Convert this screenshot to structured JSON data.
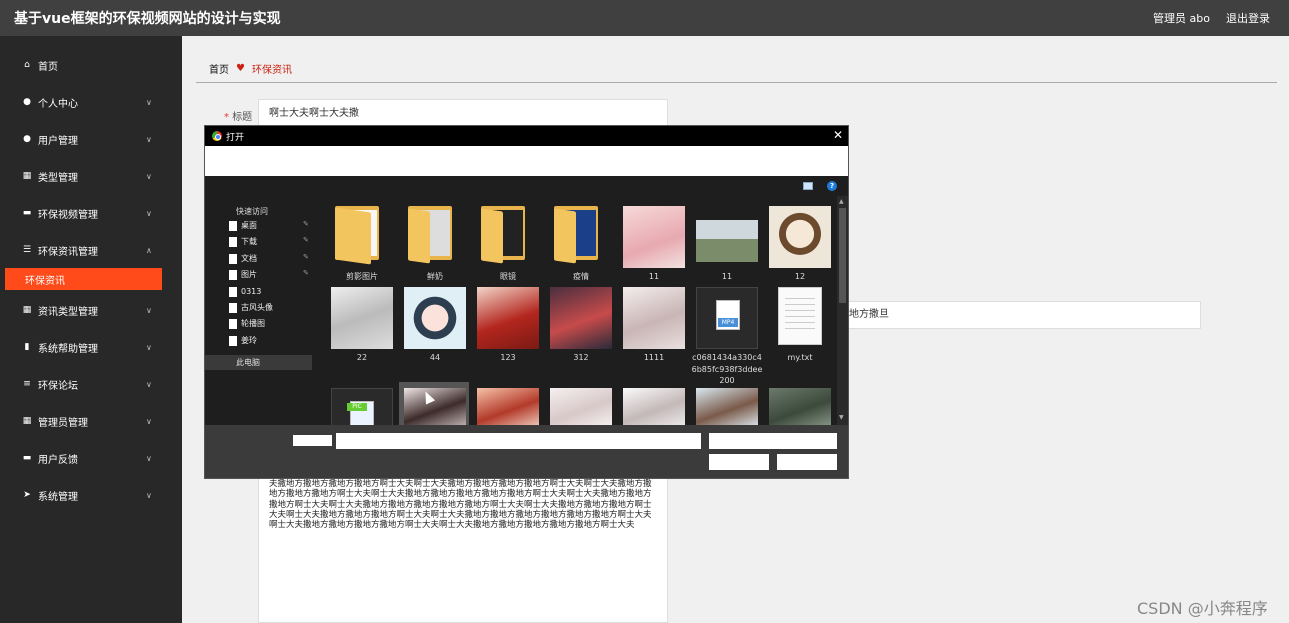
{
  "header": {
    "title": "基于vue框架的环保视频网站的设计与实现",
    "user": "管理员 abo",
    "logout": "退出登录"
  },
  "sidebar": {
    "items": [
      {
        "label": "首页",
        "icon": "home-icon"
      },
      {
        "label": "个人中心",
        "icon": "user-icon"
      },
      {
        "label": "用户管理",
        "icon": "user-icon"
      },
      {
        "label": "类型管理",
        "icon": "grid-icon"
      },
      {
        "label": "环保视频管理",
        "icon": "monitor-icon"
      },
      {
        "label": "环保资讯管理",
        "icon": "sliders-icon"
      },
      {
        "label": "环保资讯",
        "icon": ""
      },
      {
        "label": "资讯类型管理",
        "icon": "grid-icon"
      },
      {
        "label": "系统帮助管理",
        "icon": "bar-chart-icon"
      },
      {
        "label": "环保论坛",
        "icon": "list-icon"
      },
      {
        "label": "管理员管理",
        "icon": "grid-icon"
      },
      {
        "label": "用户反馈",
        "icon": "monitor-icon"
      },
      {
        "label": "系统管理",
        "icon": "send-icon"
      }
    ],
    "active_index": 6,
    "active_color": "#ff4a1a"
  },
  "breadcrumb": {
    "home": "首页",
    "current": "环保资讯"
  },
  "form": {
    "title_label": "标题",
    "title_value": "啊士大夫啊士大夫撒",
    "right_field_value": "地方撒旦",
    "content_text": "夫撒地方撒地方撒地方撒地方啊士大夫啊士大夫撒地方撒地方撒地方撒地方啊士大夫啊士大夫撒地方撒地方撒地方撒地方啊士大夫啊士大夫撒地方撒地方撒地方撒地方撒地方啊士大夫啊士大夫撒地方撒地方撒地方啊士大夫啊士大夫撒地方撒地方撒地方撒地方撒地方啊士大夫啊士大夫撒地方撒地方撒地方啊士大夫啊士大夫撒地方撒地方撒地方啊士大夫啊士大夫撒地方撒地方撒地方撒地方撒地方撒地方啊士大夫啊士大夫撒地方撒地方撒地方撒地方啊士大夫啊士大夫撒地方撒地方撒地方撒地方撒地方啊士大夫"
  },
  "dialog": {
    "title": "打开",
    "quick_access": "快速访问",
    "nav_items": [
      {
        "label": "桌面",
        "pinned": true
      },
      {
        "label": "下载",
        "pinned": true
      },
      {
        "label": "文档",
        "pinned": true
      },
      {
        "label": "图片",
        "pinned": true
      },
      {
        "label": "0313",
        "pinned": false
      },
      {
        "label": "古风头像",
        "pinned": false
      },
      {
        "label": "轮播图",
        "pinned": false
      },
      {
        "label": "姜玲",
        "pinned": false
      }
    ],
    "this_pc": "此电脑",
    "files": [
      {
        "name": "剪影图片",
        "kind": "folder"
      },
      {
        "name": "鲜奶",
        "kind": "folder"
      },
      {
        "name": "眼镜",
        "kind": "folder"
      },
      {
        "name": "疫情",
        "kind": "folder"
      },
      {
        "name": "11",
        "kind": "image"
      },
      {
        "name": "11",
        "kind": "image"
      },
      {
        "name": "12",
        "kind": "image"
      },
      {
        "name": "22",
        "kind": "image"
      },
      {
        "name": "44",
        "kind": "image"
      },
      {
        "name": "123",
        "kind": "image"
      },
      {
        "name": "312",
        "kind": "image"
      },
      {
        "name": "1111",
        "kind": "image"
      },
      {
        "name": "c0681434a330c46b85fc938f3ddee200",
        "kind": "video"
      },
      {
        "name": "my.txt",
        "kind": "text"
      },
      {
        "name": "",
        "kind": "pic"
      },
      {
        "name": "",
        "kind": "image"
      },
      {
        "name": "",
        "kind": "image"
      },
      {
        "name": "",
        "kind": "image"
      },
      {
        "name": "",
        "kind": "image"
      },
      {
        "name": "",
        "kind": "image"
      },
      {
        "name": "",
        "kind": "image"
      }
    ],
    "mp4_tag": "MP4",
    "pic_tag": "PIC",
    "help_glyph": "?"
  },
  "watermark": "CSDN @小奔程序"
}
